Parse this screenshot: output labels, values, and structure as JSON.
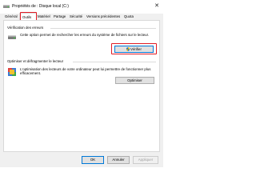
{
  "window": {
    "title": "Propriétés de : Disque local (C:)",
    "close_label": "✕"
  },
  "tabs": [
    {
      "label": "Général",
      "active": false
    },
    {
      "label": "Outils",
      "active": true
    },
    {
      "label": "Matériel",
      "active": false
    },
    {
      "label": "Partage",
      "active": false
    },
    {
      "label": "Sécurité",
      "active": false
    },
    {
      "label": "Versions précédentes",
      "active": false
    },
    {
      "label": "Quota",
      "active": false
    }
  ],
  "error_check": {
    "title": "Vérification des erreurs",
    "description": "Cette option permet de rechercher les erreurs du système de fichiers sur le lecteur.",
    "button_label": "Vérifier",
    "icon": "drive-icon"
  },
  "optimize": {
    "title": "Optimiser et défragmenter le lecteur",
    "description": "L'optimisation des lecteurs de votre ordinateur peut lui permettre de fonctionner plus efficacement.",
    "button_label": "Optimiser",
    "icon": "defrag-icon"
  },
  "footer": {
    "ok_label": "OK",
    "cancel_label": "Annuler",
    "apply_label": "Appliquer"
  },
  "colors": {
    "highlight": "#e01b24",
    "accent": "#0078d7"
  }
}
